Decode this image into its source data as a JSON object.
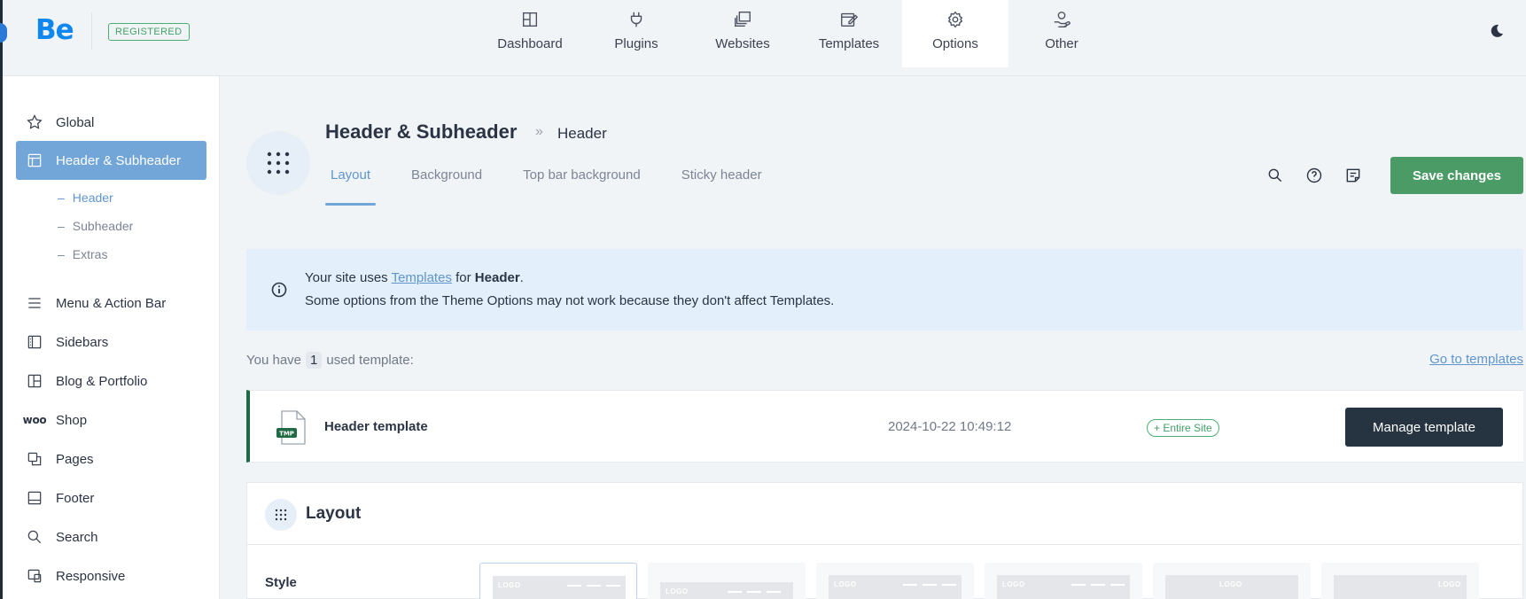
{
  "app": {
    "logo_text": "Be",
    "registered_badge": "REGISTERED",
    "theme_toggle_icon": "moon-icon"
  },
  "topnav": [
    {
      "label": "Dashboard",
      "icon": "dashboard-icon",
      "active": false
    },
    {
      "label": "Plugins",
      "icon": "plug-icon",
      "active": false
    },
    {
      "label": "Websites",
      "icon": "websites-icon",
      "active": false
    },
    {
      "label": "Templates",
      "icon": "templates-icon",
      "active": false
    },
    {
      "label": "Options",
      "icon": "gear-icon",
      "active": true
    },
    {
      "label": "Other",
      "icon": "hand-icon",
      "active": false
    }
  ],
  "sidebar": {
    "items": [
      {
        "label": "Global",
        "icon": "star-icon"
      },
      {
        "label": "Header & Subheader",
        "icon": "header-icon",
        "active": true
      },
      {
        "label": "Menu & Action Bar",
        "icon": "menu-icon"
      },
      {
        "label": "Sidebars",
        "icon": "sidebar-icon"
      },
      {
        "label": "Blog & Portfolio",
        "icon": "blog-icon"
      },
      {
        "label": "Shop",
        "icon": "woo-icon",
        "icon_text": "woo"
      },
      {
        "label": "Pages",
        "icon": "pages-icon"
      },
      {
        "label": "Footer",
        "icon": "footer-icon"
      },
      {
        "label": "Search",
        "icon": "search-icon"
      },
      {
        "label": "Responsive",
        "icon": "responsive-icon"
      }
    ],
    "subitems": [
      {
        "label": "Header",
        "active": true
      },
      {
        "label": "Subheader",
        "active": false
      },
      {
        "label": "Extras",
        "active": false
      }
    ],
    "subitem_marker": "–"
  },
  "page": {
    "title": "Header & Subheader",
    "breadcrumb_separator": "»",
    "breadcrumb_current": "Header",
    "tabs": [
      {
        "label": "Layout",
        "active": true
      },
      {
        "label": "Background",
        "active": false
      },
      {
        "label": "Top bar background",
        "active": false
      },
      {
        "label": "Sticky header",
        "active": false
      }
    ],
    "save_label": "Save changes"
  },
  "notice": {
    "prefix": "Your site uses ",
    "link": "Templates",
    "middle": " for ",
    "bold": "Header",
    "suffix": ".",
    "line2": "Some options from the Theme Options may not work because they don't affect Templates."
  },
  "templates": {
    "count_prefix": "You have",
    "count": "1",
    "count_suffix": "used template:",
    "go_to_link": "Go to templates",
    "row": {
      "file_badge": "TMP",
      "name": "Header template",
      "date": "2024-10-22 10:49:12",
      "scope": "+ Entire Site",
      "manage_label": "Manage template"
    }
  },
  "layout_section": {
    "title": "Layout",
    "style_label": "Style",
    "thumb_logo_text": "LOGO"
  }
}
